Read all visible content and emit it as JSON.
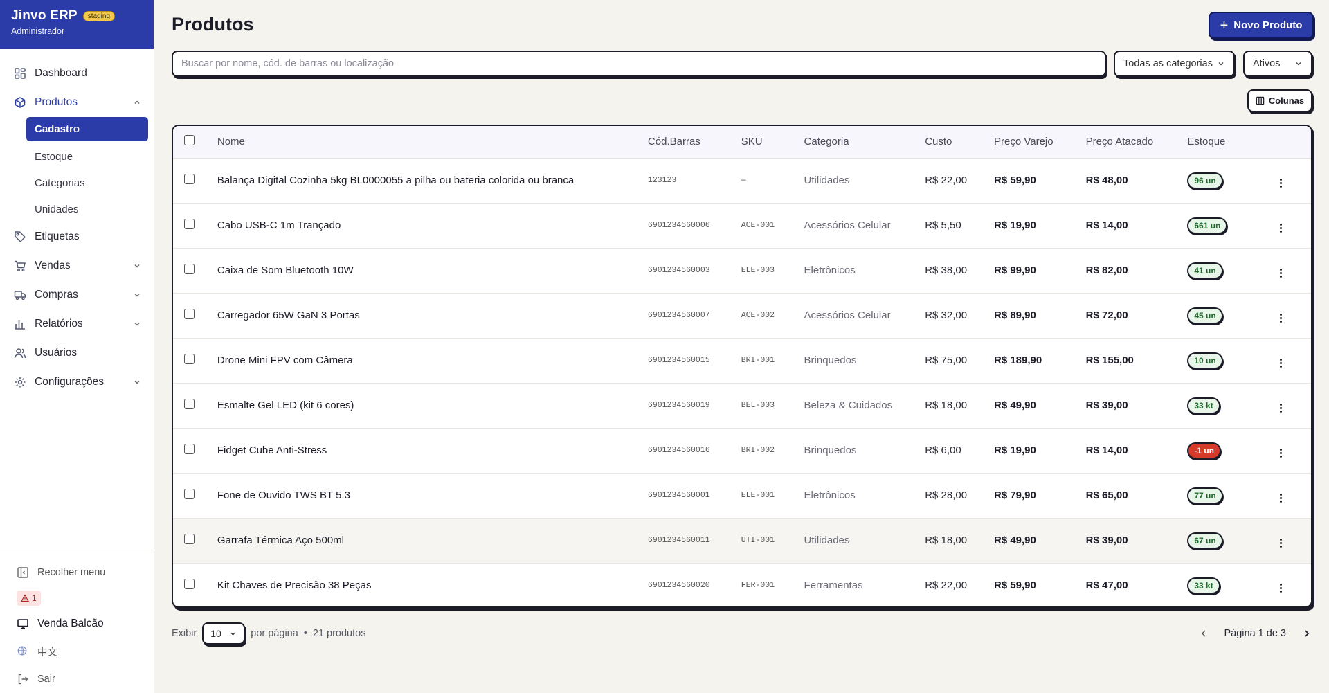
{
  "brand": {
    "name": "Jinvo ERP",
    "env": "staging",
    "role": "Administrador"
  },
  "nav": {
    "dashboard": "Dashboard",
    "produtos": "Produtos",
    "produtos_sub": {
      "cadastro": "Cadastro",
      "estoque": "Estoque",
      "categorias": "Categorias",
      "unidades": "Unidades"
    },
    "etiquetas": "Etiquetas",
    "vendas": "Vendas",
    "compras": "Compras",
    "relatorios": "Relatórios",
    "usuarios": "Usuários",
    "configuracoes": "Configurações"
  },
  "sidebar_bottom": {
    "collapse": "Recolher menu",
    "alerts": "1",
    "pos": "Venda Balcão",
    "language": "中文",
    "logout": "Sair"
  },
  "page": {
    "title": "Produtos",
    "new_button": "Novo Produto"
  },
  "filters": {
    "search_placeholder": "Buscar por nome, cód. de barras ou localização",
    "category": "Todas as categorias",
    "status": "Ativos",
    "columns_button": "Colunas"
  },
  "table": {
    "headers": {
      "name": "Nome",
      "barcode": "Cód.Barras",
      "sku": "SKU",
      "category": "Categoria",
      "cost": "Custo",
      "retail": "Preço Varejo",
      "wholesale": "Preço Atacado",
      "stock": "Estoque"
    },
    "rows": [
      {
        "name": "Balança Digital Cozinha 5kg BL0000055 a pilha ou bateria colorida ou branca",
        "barcode": "123123",
        "sku": "—",
        "category": "Utilidades",
        "cost": "R$ 22,00",
        "retail": "R$ 59,90",
        "wholesale": "R$ 48,00",
        "stock": "96 un"
      },
      {
        "name": "Cabo USB-C 1m Trançado",
        "barcode": "6901234560006",
        "sku": "ACE-001",
        "category": "Acessórios Celular",
        "cost": "R$ 5,50",
        "retail": "R$ 19,90",
        "wholesale": "R$ 14,00",
        "stock": "661 un"
      },
      {
        "name": "Caixa de Som Bluetooth 10W",
        "barcode": "6901234560003",
        "sku": "ELE-003",
        "category": "Eletrônicos",
        "cost": "R$ 38,00",
        "retail": "R$ 99,90",
        "wholesale": "R$ 82,00",
        "stock": "41 un"
      },
      {
        "name": "Carregador 65W GaN 3 Portas",
        "barcode": "6901234560007",
        "sku": "ACE-002",
        "category": "Acessórios Celular",
        "cost": "R$ 32,00",
        "retail": "R$ 89,90",
        "wholesale": "R$ 72,00",
        "stock": "45 un"
      },
      {
        "name": "Drone Mini FPV com Câmera",
        "barcode": "6901234560015",
        "sku": "BRI-001",
        "category": "Brinquedos",
        "cost": "R$ 75,00",
        "retail": "R$ 189,90",
        "wholesale": "R$ 155,00",
        "stock": "10 un"
      },
      {
        "name": "Esmalte Gel LED (kit 6 cores)",
        "barcode": "6901234560019",
        "sku": "BEL-003",
        "category": "Beleza & Cuidados",
        "cost": "R$ 18,00",
        "retail": "R$ 49,90",
        "wholesale": "R$ 39,00",
        "stock": "33 kt"
      },
      {
        "name": "Fidget Cube Anti-Stress",
        "barcode": "6901234560016",
        "sku": "BRI-002",
        "category": "Brinquedos",
        "cost": "R$ 6,00",
        "retail": "R$ 19,90",
        "wholesale": "R$ 14,00",
        "stock": "-1 un"
      },
      {
        "name": "Fone de Ouvido TWS BT 5.3",
        "barcode": "6901234560001",
        "sku": "ELE-001",
        "category": "Eletrônicos",
        "cost": "R$ 28,00",
        "retail": "R$ 79,90",
        "wholesale": "R$ 65,00",
        "stock": "77 un"
      },
      {
        "name": "Garrafa Térmica Aço 500ml",
        "barcode": "6901234560011",
        "sku": "UTI-001",
        "category": "Utilidades",
        "cost": "R$ 18,00",
        "retail": "R$ 49,90",
        "wholesale": "R$ 39,00",
        "stock": "67 un"
      },
      {
        "name": "Kit Chaves de Precisão 38 Peças",
        "barcode": "6901234560020",
        "sku": "FER-001",
        "category": "Ferramentas",
        "cost": "R$ 22,00",
        "retail": "R$ 59,90",
        "wholesale": "R$ 47,00",
        "stock": "33 kt"
      }
    ]
  },
  "footer": {
    "show_label": "Exibir",
    "per_page_value": "10",
    "per_page_label": "por página",
    "separator": "•",
    "total": "21 produtos",
    "page_info": "Página 1 de 3"
  },
  "colors": {
    "primary": "#2b3ba8",
    "stock_ok_bg": "#e7f6e9",
    "stock_negative_bg": "#d63a2a",
    "staging_badge": "#f2c94c"
  }
}
